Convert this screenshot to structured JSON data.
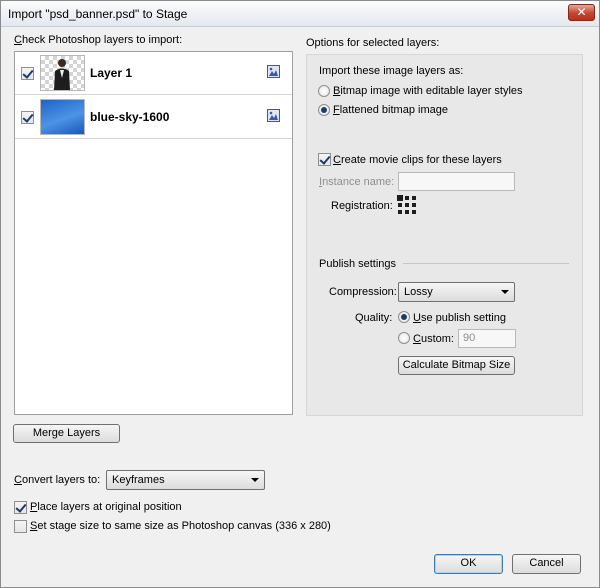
{
  "window": {
    "title": "Import \"psd_banner.psd\" to Stage",
    "close_glyph": "✕"
  },
  "layers_section": {
    "label_prefix": "C",
    "label_rest": "heck Photoshop layers to import:",
    "layers": [
      {
        "name": "Layer 1",
        "checked": true,
        "thumbnail_icon": "person-silhouette-icon"
      },
      {
        "name": "blue-sky-1600",
        "checked": true,
        "thumbnail_icon": "blue-sky-image-icon"
      }
    ]
  },
  "merge_button": "Merge Layers",
  "options": {
    "heading": "Options for selected layers:",
    "import_as_label": "Import these image layers as:",
    "radio_editable_prefix": "B",
    "radio_editable_rest": "itmap image with editable layer styles",
    "radio_flattened_prefix": "F",
    "radio_flattened_rest": "lattened bitmap image",
    "create_movie_clips_prefix": "C",
    "create_movie_clips_rest": "reate movie clips for these layers",
    "instance_name_prefix": "I",
    "instance_name_rest": "nstance name:",
    "instance_name_value": "",
    "registration_label": "Registration:",
    "publish_settings_heading": "Publish settings",
    "compression_prefix": "Compression:",
    "compression_value": "Lossy",
    "quality_label": "Quality:",
    "quality_publish_prefix": "U",
    "quality_publish_rest": "se publish setting",
    "quality_custom_prefix": "C",
    "quality_custom_rest": "ustom:",
    "quality_custom_value": "90",
    "calc_button": "Calculate Bitmap Size"
  },
  "convert": {
    "label_prefix": "C",
    "label_rest": "onvert layers to:",
    "value": "Keyframes"
  },
  "place_original": {
    "prefix": "P",
    "rest": "lace layers at original position",
    "checked": true
  },
  "stage_size": {
    "prefix": "S",
    "rest": "et stage size to same size as Photoshop canvas (336 x 280)",
    "checked": false
  },
  "ok_button": "OK",
  "cancel_button": "Cancel"
}
